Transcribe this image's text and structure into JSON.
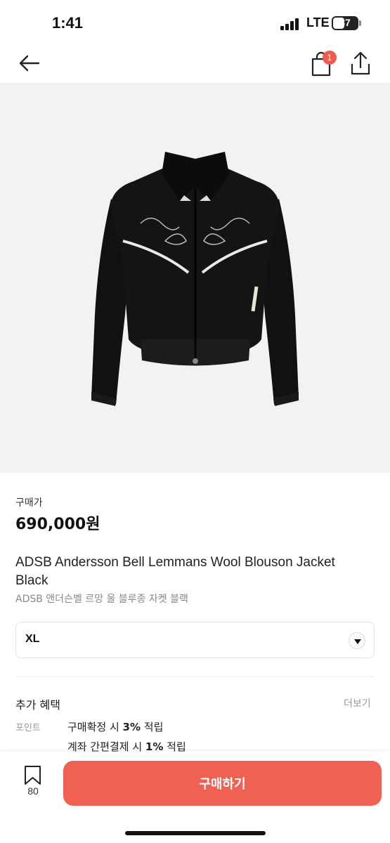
{
  "status_bar": {
    "time": "1:41",
    "network": "LTE",
    "battery_level": "37"
  },
  "nav": {
    "cart_badge": "1"
  },
  "product": {
    "price_label": "구매가",
    "price": "690,000원",
    "title": "ADSB Andersson Bell Lemmans Wool Blouson Jacket Black",
    "subtitle": "ADSB 앤더슨벨 르망 울 블루종 자켓 블랙"
  },
  "size_select": {
    "selected": "XL"
  },
  "benefits": {
    "title": "추가 혜택",
    "more": "더보기",
    "points_label": "포인트",
    "line1": {
      "prefix": "구매확정 시 ",
      "highlight": "3%",
      "suffix": " 적립"
    },
    "line2": {
      "prefix": "계좌 간편결제 시 ",
      "highlight": "1%",
      "suffix": " 적립"
    }
  },
  "bottom_bar": {
    "bookmark_count": "80",
    "buy_label": "구매하기"
  },
  "colors": {
    "accent": "#ef6253",
    "badge": "#ef5b4c",
    "image_bg": "#f2f2f2"
  },
  "icons": [
    "back-arrow-icon",
    "shopping-bag-icon",
    "share-icon",
    "bookmark-icon",
    "chevron-down-icon",
    "signal-icon",
    "battery-icon"
  ]
}
